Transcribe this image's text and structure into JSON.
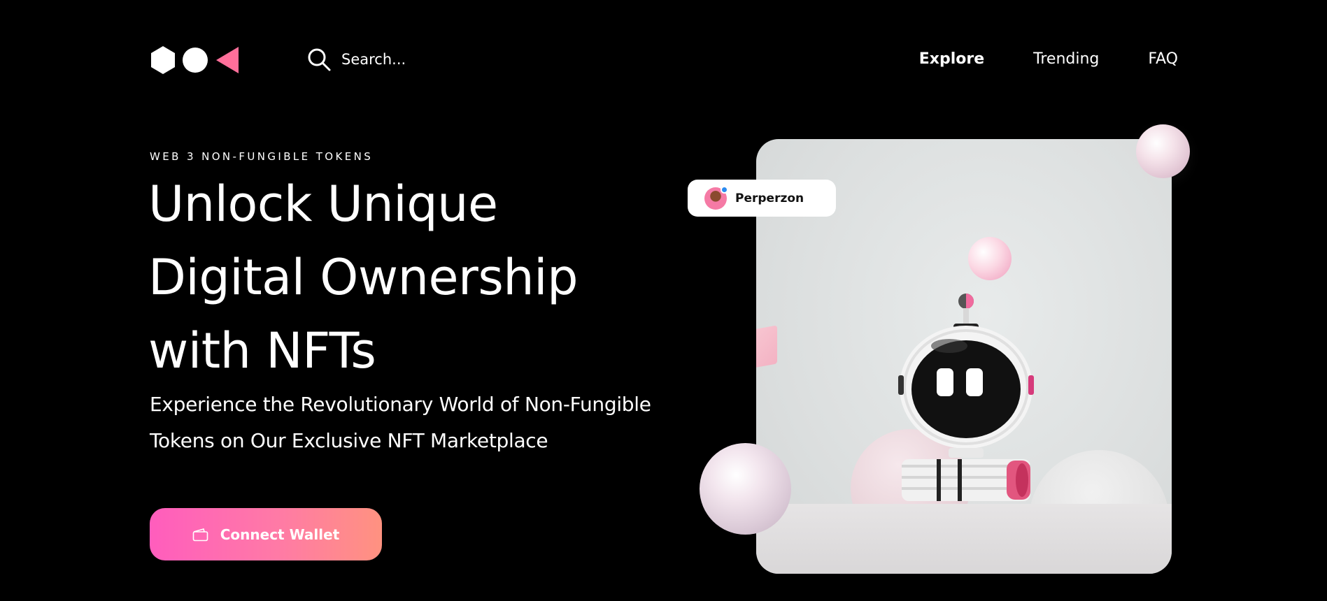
{
  "header": {
    "search_placeholder": "Search...",
    "nav": [
      {
        "label": "Explore",
        "active": true
      },
      {
        "label": "Trending",
        "active": false
      },
      {
        "label": "FAQ",
        "active": false
      }
    ]
  },
  "hero": {
    "eyebrow": "WEB 3 NON-FUNGIBLE TOKENS",
    "headline_lines": [
      "Unlock Unique",
      "Digital Ownership",
      "with NFTs"
    ],
    "subtitle_lines": [
      "Experience the Revolutionary World of Non-Fungible",
      "Tokens on Our Exclusive NFT Marketplace"
    ],
    "cta_label": "Connect Wallet"
  },
  "artwork": {
    "creator_name": "Perperzon"
  },
  "colors": {
    "background": "#000000",
    "accent_pink": "#ff5dbd",
    "accent_coral": "#ff9280",
    "logo_pink": "#ff6f9a",
    "verified_blue": "#2b8cf0"
  },
  "icons": [
    "logo-hexagon-icon",
    "logo-circle-icon",
    "logo-triangle-icon",
    "search-icon",
    "wallet-icon",
    "verified-badge-icon"
  ]
}
